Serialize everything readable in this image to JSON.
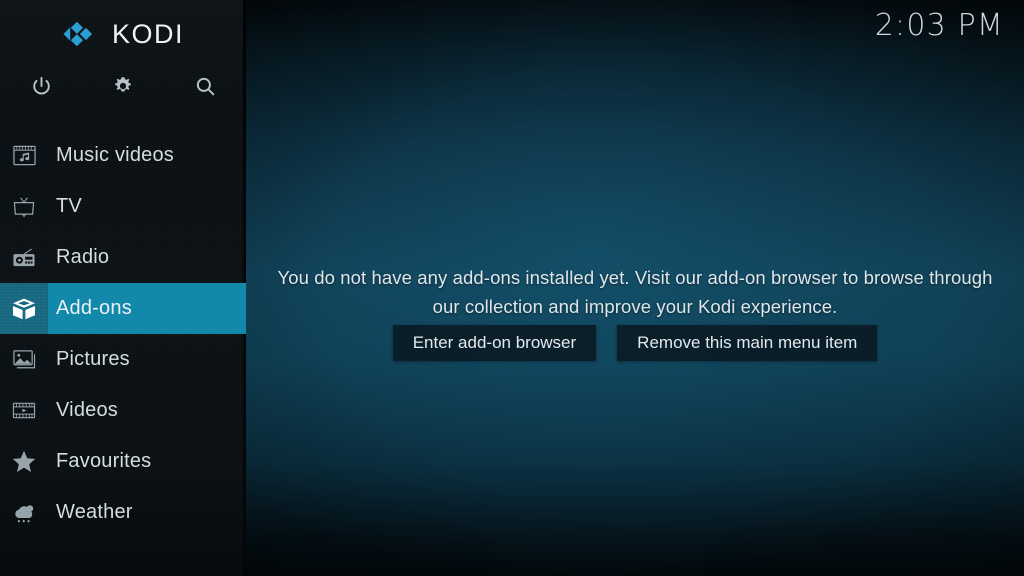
{
  "app": {
    "name": "KODI",
    "logo_icon": "kodi-logo-icon",
    "accent_color": "#1289ab",
    "accent_dark_color": "#14677f"
  },
  "header": {
    "clock": "2:03 PM"
  },
  "sidebar": {
    "top_icons": [
      {
        "name": "power-icon",
        "label": "Power"
      },
      {
        "name": "settings-gear-icon",
        "label": "Settings"
      },
      {
        "name": "search-icon",
        "label": "Search"
      }
    ],
    "items": [
      {
        "label": "Music videos",
        "icon": "music-videos-icon",
        "selected": false
      },
      {
        "label": "TV",
        "icon": "tv-icon",
        "selected": false
      },
      {
        "label": "Radio",
        "icon": "radio-icon",
        "selected": false
      },
      {
        "label": "Add-ons",
        "icon": "addons-box-icon",
        "selected": true
      },
      {
        "label": "Pictures",
        "icon": "pictures-icon",
        "selected": false
      },
      {
        "label": "Videos",
        "icon": "videos-filmstrip-icon",
        "selected": false
      },
      {
        "label": "Favourites",
        "icon": "star-icon",
        "selected": false
      },
      {
        "label": "Weather",
        "icon": "weather-cloud-rain-icon",
        "selected": false
      }
    ]
  },
  "main": {
    "message": "You do not have any add-ons installed yet. Visit our add-on browser to browse through our collection and improve your Kodi experience.",
    "buttons": [
      {
        "label": "Enter add-on browser",
        "name": "enter-addon-browser-button"
      },
      {
        "label": "Remove this main menu item",
        "name": "remove-main-menu-item-button"
      }
    ]
  }
}
